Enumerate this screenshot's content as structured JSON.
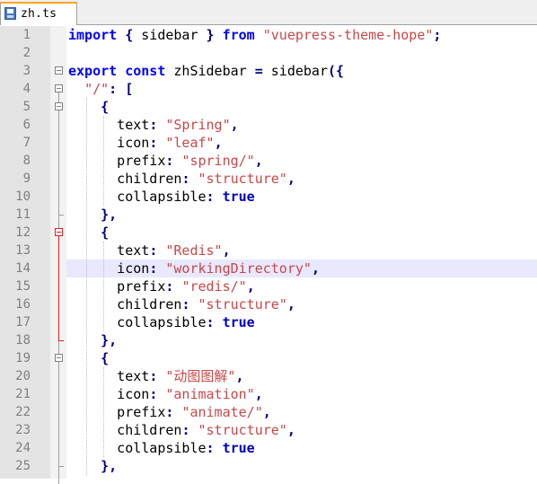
{
  "tab": {
    "icon": "file-save-icon",
    "label": "zh.ts"
  },
  "editor": {
    "current_line": 14,
    "lines": [
      {
        "n": "1",
        "tokens": [
          {
            "t": "kw",
            "v": "import"
          },
          {
            "t": "plain",
            "v": " "
          },
          {
            "t": "op",
            "v": "{"
          },
          {
            "t": "plain",
            "v": " sidebar "
          },
          {
            "t": "op",
            "v": "}"
          },
          {
            "t": "plain",
            "v": " "
          },
          {
            "t": "kw",
            "v": "from"
          },
          {
            "t": "plain",
            "v": " "
          },
          {
            "t": "str",
            "v": "\"vuepress-theme-hope\""
          },
          {
            "t": "op",
            "v": ";"
          }
        ]
      },
      {
        "n": "2",
        "tokens": []
      },
      {
        "n": "3",
        "tokens": [
          {
            "t": "kw",
            "v": "export"
          },
          {
            "t": "plain",
            "v": " "
          },
          {
            "t": "kw",
            "v": "const"
          },
          {
            "t": "plain",
            "v": " zhSidebar "
          },
          {
            "t": "op",
            "v": "="
          },
          {
            "t": "plain",
            "v": " sidebar"
          },
          {
            "t": "op",
            "v": "({"
          }
        ]
      },
      {
        "n": "4",
        "tokens": [
          {
            "t": "plain",
            "v": "  "
          },
          {
            "t": "str",
            "v": "\"/\""
          },
          {
            "t": "op",
            "v": ":"
          },
          {
            "t": "plain",
            "v": " "
          },
          {
            "t": "op",
            "v": "["
          }
        ]
      },
      {
        "n": "5",
        "tokens": [
          {
            "t": "plain",
            "v": "    "
          },
          {
            "t": "op",
            "v": "{"
          }
        ]
      },
      {
        "n": "6",
        "tokens": [
          {
            "t": "plain",
            "v": "      text"
          },
          {
            "t": "op",
            "v": ":"
          },
          {
            "t": "plain",
            "v": " "
          },
          {
            "t": "str",
            "v": "\"Spring\""
          },
          {
            "t": "op",
            "v": ","
          }
        ]
      },
      {
        "n": "7",
        "tokens": [
          {
            "t": "plain",
            "v": "      icon"
          },
          {
            "t": "op",
            "v": ":"
          },
          {
            "t": "plain",
            "v": " "
          },
          {
            "t": "str",
            "v": "\"leaf\""
          },
          {
            "t": "op",
            "v": ","
          }
        ]
      },
      {
        "n": "8",
        "tokens": [
          {
            "t": "plain",
            "v": "      prefix"
          },
          {
            "t": "op",
            "v": ":"
          },
          {
            "t": "plain",
            "v": " "
          },
          {
            "t": "str",
            "v": "\"spring/\""
          },
          {
            "t": "op",
            "v": ","
          }
        ]
      },
      {
        "n": "9",
        "tokens": [
          {
            "t": "plain",
            "v": "      children"
          },
          {
            "t": "op",
            "v": ":"
          },
          {
            "t": "plain",
            "v": " "
          },
          {
            "t": "str",
            "v": "\"structure\""
          },
          {
            "t": "op",
            "v": ","
          }
        ]
      },
      {
        "n": "10",
        "tokens": [
          {
            "t": "plain",
            "v": "      collapsible"
          },
          {
            "t": "op",
            "v": ":"
          },
          {
            "t": "plain",
            "v": " "
          },
          {
            "t": "boolv",
            "v": "true"
          }
        ]
      },
      {
        "n": "11",
        "tokens": [
          {
            "t": "plain",
            "v": "    "
          },
          {
            "t": "op",
            "v": "},"
          }
        ]
      },
      {
        "n": "12",
        "tokens": [
          {
            "t": "plain",
            "v": "    "
          },
          {
            "t": "op",
            "v": "{"
          }
        ]
      },
      {
        "n": "13",
        "tokens": [
          {
            "t": "plain",
            "v": "      text"
          },
          {
            "t": "op",
            "v": ":"
          },
          {
            "t": "plain",
            "v": " "
          },
          {
            "t": "str",
            "v": "\"Redis\""
          },
          {
            "t": "op",
            "v": ","
          }
        ]
      },
      {
        "n": "14",
        "tokens": [
          {
            "t": "plain",
            "v": "      icon"
          },
          {
            "t": "op",
            "v": ":"
          },
          {
            "t": "plain",
            "v": " "
          },
          {
            "t": "str",
            "v": "\"workingDirectory\""
          },
          {
            "t": "op",
            "v": ","
          }
        ]
      },
      {
        "n": "15",
        "tokens": [
          {
            "t": "plain",
            "v": "      prefix"
          },
          {
            "t": "op",
            "v": ":"
          },
          {
            "t": "plain",
            "v": " "
          },
          {
            "t": "str",
            "v": "\"redis/\""
          },
          {
            "t": "op",
            "v": ","
          }
        ]
      },
      {
        "n": "16",
        "tokens": [
          {
            "t": "plain",
            "v": "      children"
          },
          {
            "t": "op",
            "v": ":"
          },
          {
            "t": "plain",
            "v": " "
          },
          {
            "t": "str",
            "v": "\"structure\""
          },
          {
            "t": "op",
            "v": ","
          }
        ]
      },
      {
        "n": "17",
        "tokens": [
          {
            "t": "plain",
            "v": "      collapsible"
          },
          {
            "t": "op",
            "v": ":"
          },
          {
            "t": "plain",
            "v": " "
          },
          {
            "t": "boolv",
            "v": "true"
          }
        ]
      },
      {
        "n": "18",
        "tokens": [
          {
            "t": "plain",
            "v": "    "
          },
          {
            "t": "op",
            "v": "},"
          }
        ]
      },
      {
        "n": "19",
        "tokens": [
          {
            "t": "plain",
            "v": "    "
          },
          {
            "t": "op",
            "v": "{"
          }
        ]
      },
      {
        "n": "20",
        "tokens": [
          {
            "t": "plain",
            "v": "      text"
          },
          {
            "t": "op",
            "v": ":"
          },
          {
            "t": "plain",
            "v": " "
          },
          {
            "t": "str",
            "v": "\"动图图解\""
          },
          {
            "t": "op",
            "v": ","
          }
        ]
      },
      {
        "n": "21",
        "tokens": [
          {
            "t": "plain",
            "v": "      icon"
          },
          {
            "t": "op",
            "v": ":"
          },
          {
            "t": "plain",
            "v": " "
          },
          {
            "t": "str",
            "v": "\"animation\""
          },
          {
            "t": "op",
            "v": ","
          }
        ]
      },
      {
        "n": "22",
        "tokens": [
          {
            "t": "plain",
            "v": "      prefix"
          },
          {
            "t": "op",
            "v": ":"
          },
          {
            "t": "plain",
            "v": " "
          },
          {
            "t": "str",
            "v": "\"animate/\""
          },
          {
            "t": "op",
            "v": ","
          }
        ]
      },
      {
        "n": "23",
        "tokens": [
          {
            "t": "plain",
            "v": "      children"
          },
          {
            "t": "op",
            "v": ":"
          },
          {
            "t": "plain",
            "v": " "
          },
          {
            "t": "str",
            "v": "\"structure\""
          },
          {
            "t": "op",
            "v": ","
          }
        ]
      },
      {
        "n": "24",
        "tokens": [
          {
            "t": "plain",
            "v": "      collapsible"
          },
          {
            "t": "op",
            "v": ":"
          },
          {
            "t": "plain",
            "v": " "
          },
          {
            "t": "boolv",
            "v": "true"
          }
        ]
      },
      {
        "n": "25",
        "tokens": [
          {
            "t": "plain",
            "v": "    "
          },
          {
            "t": "op",
            "v": "},"
          }
        ]
      }
    ]
  }
}
